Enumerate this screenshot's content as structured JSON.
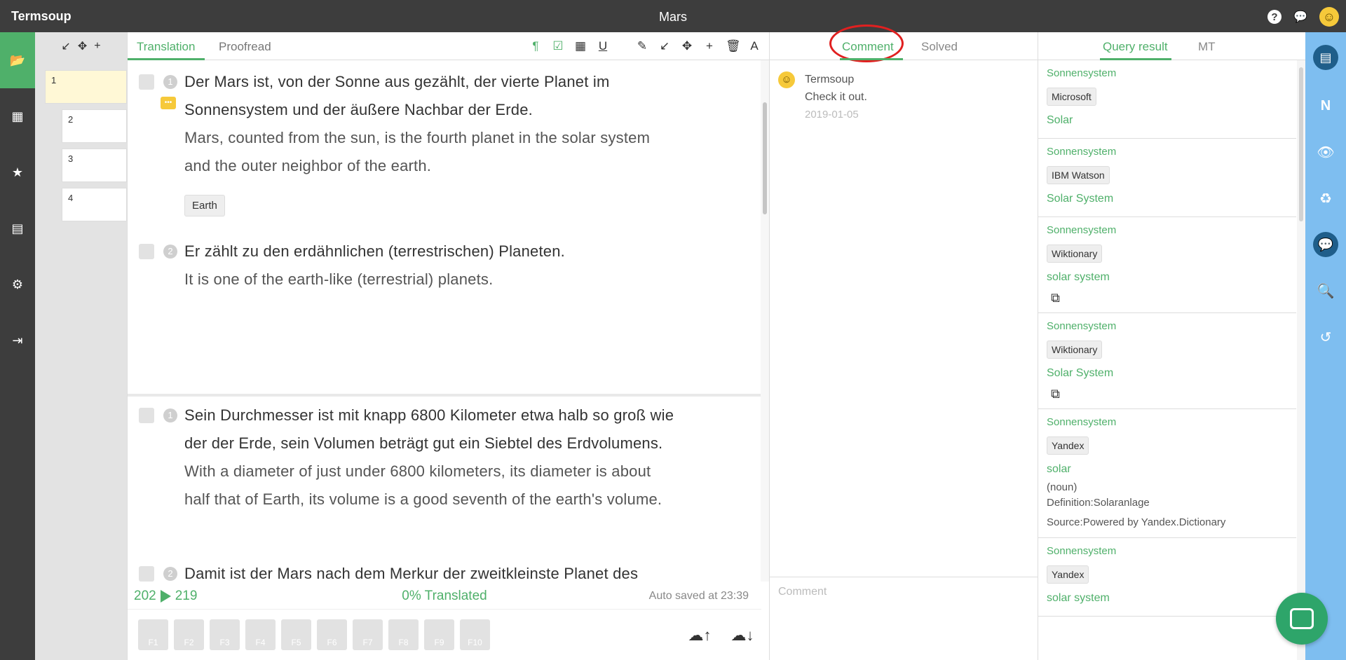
{
  "app": {
    "brand": "Termsoup",
    "document_title": "Mars"
  },
  "topbar": {
    "help_icon": "?",
    "chat_icon": "💬",
    "user_icon": "☺"
  },
  "leftnav": {
    "items": [
      {
        "icon": "📂",
        "name": "projects"
      },
      {
        "icon": "▦",
        "name": "glossary"
      },
      {
        "icon": "★",
        "name": "favorites"
      },
      {
        "icon": "▤",
        "name": "store"
      },
      {
        "icon": "⚙",
        "name": "settings"
      },
      {
        "icon": "⇥",
        "name": "logout"
      }
    ]
  },
  "thumbnails": {
    "tools": [
      "↙",
      "✥",
      "+"
    ],
    "pages": [
      "1",
      "2",
      "3",
      "4"
    ]
  },
  "editor": {
    "tabs": [
      "Translation",
      "Proofread"
    ],
    "tools_green": [
      "¶",
      "☑",
      "▦",
      "U"
    ],
    "tools_dark": [
      "✎",
      "↙",
      "✥",
      "+",
      "🗑",
      "A"
    ],
    "segments": [
      {
        "num": "1",
        "src_lines": [
          "Der Mars ist, von der Sonne aus gezählt, der vierte Planet im",
          "Sonnensystem und der äußere Nachbar der Erde."
        ],
        "tgt_lines": [
          "Mars, counted from the sun, is the fourth planet in the solar system",
          "and the outer neighbor of the earth."
        ],
        "term": "Earth"
      },
      {
        "num": "2",
        "src_lines": [
          "Er zählt zu den erdähnlichen (terrestrischen) Planeten."
        ],
        "tgt_lines": [
          "It is one of the earth-like (terrestrial) planets."
        ]
      },
      {
        "num": "1",
        "src_lines": [
          "Sein Durchmesser ist mit knapp 6800 Kilometer etwa halb so groß wie",
          "der der Erde, sein Volumen beträgt gut ein Siebtel des Erdvolumens."
        ],
        "tgt_lines": [
          "With a diameter of just under 6800 kilometers, its diameter is about",
          "half that of Earth, its volume is a good seventh of the earth's volume."
        ]
      },
      {
        "num": "2",
        "src_lines": [
          "Damit ist der Mars nach dem Merkur der zweitkleinste Planet des"
        ],
        "tgt_lines": []
      }
    ],
    "status": {
      "from": "202",
      "to": "219",
      "translated": "0% Translated",
      "autosave": "Auto saved at 23:39"
    },
    "fkeys": [
      "F1",
      "F2",
      "F3",
      "F4",
      "F5",
      "F6",
      "F7",
      "F8",
      "F9",
      "F10"
    ],
    "upload_icon": "☁↑",
    "download_icon": "☁↓"
  },
  "comments": {
    "tabs": [
      "Comment",
      "Solved"
    ],
    "entry": {
      "author": "Termsoup",
      "text": "Check it out.",
      "date": "2019-01-05"
    },
    "input_placeholder": "Comment"
  },
  "query": {
    "tabs": [
      "Query result",
      "MT"
    ],
    "results": [
      {
        "source": "Sonnensystem",
        "provider": "Microsoft",
        "target": "Solar"
      },
      {
        "source": "Sonnensystem",
        "provider": "IBM Watson",
        "target": "Solar System"
      },
      {
        "source": "Sonnensystem",
        "provider": "Wiktionary",
        "target": "solar system",
        "ext": "⧉"
      },
      {
        "source": "Sonnensystem",
        "provider": "Wiktionary",
        "target": "Solar System",
        "ext": "⧉"
      },
      {
        "source": "Sonnensystem",
        "provider": "Yandex",
        "target": "solar",
        "notes": [
          "(noun)\nDefinition:Solaranlage",
          "Source:Powered by Yandex.Dictionary"
        ]
      },
      {
        "source": "Sonnensystem",
        "provider": "Yandex",
        "target": "solar system"
      }
    ]
  },
  "rightbar": {
    "items": [
      "▤",
      "N",
      "👁",
      "♻",
      "💬",
      "🔍",
      "↺"
    ]
  }
}
